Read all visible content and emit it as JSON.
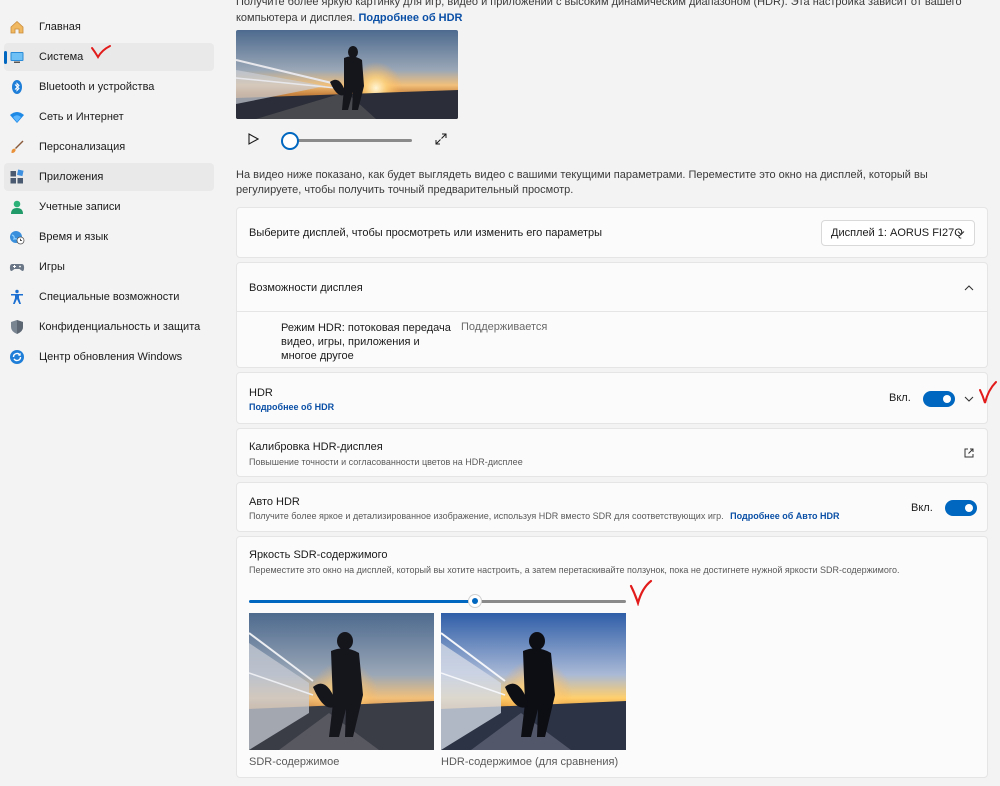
{
  "sidebar": {
    "items": [
      {
        "label": "Главная",
        "icon": "home-icon"
      },
      {
        "label": "Система",
        "icon": "system-display-icon"
      },
      {
        "label": "Bluetooth и устройства",
        "icon": "bluetooth-icon"
      },
      {
        "label": "Сеть и Интернет",
        "icon": "wifi-icon"
      },
      {
        "label": "Персонализация",
        "icon": "paint-brush-icon"
      },
      {
        "label": "Приложения",
        "icon": "apps-icon"
      },
      {
        "label": "Учетные записи",
        "icon": "account-icon"
      },
      {
        "label": "Время и язык",
        "icon": "globe-clock-icon"
      },
      {
        "label": "Игры",
        "icon": "gamepad-icon"
      },
      {
        "label": "Специальные возможности",
        "icon": "accessibility-icon"
      },
      {
        "label": "Конфиденциальность и защита",
        "icon": "shield-icon"
      },
      {
        "label": "Центр обновления Windows",
        "icon": "update-icon"
      }
    ]
  },
  "intro": {
    "text": "Получите более яркую картинку для игр, видео и приложений с высоким динамическим диапазоном (HDR). Эта настройка зависит от вашего компьютера и дисплея.",
    "link": "Подробнее об HDR"
  },
  "player": {
    "progress": 0
  },
  "description": "На видео ниже показано, как будет выглядеть видео с вашими текущими параметрами. Переместите это окно на дисплей, который вы регулируете, чтобы получить точный предварительный просмотр.",
  "display_select": {
    "title": "Выберите дисплей, чтобы просмотреть или изменить его параметры",
    "value": "Дисплей 1: AORUS FI27Q"
  },
  "capabilities": {
    "title": "Возможности дисплея",
    "feature_label": "Режим HDR: потоковая передача видео, игры, приложения и многое другое",
    "feature_value": "Поддерживается"
  },
  "hdr": {
    "title": "HDR",
    "link": "Подробнее об HDR",
    "state_label": "Вкл.",
    "enabled": true
  },
  "calibration": {
    "title": "Калибровка HDR-дисплея",
    "subtitle": "Повышение точности и согласованности цветов на HDR-дисплее"
  },
  "auto_hdr": {
    "title": "Авто HDR",
    "subtitle": "Получите более яркое и детализированное изображение, используя HDR вместо SDR для соответствующих игр.",
    "link": "Подробнее об Авто HDR",
    "state_label": "Вкл.",
    "enabled": true
  },
  "sdr_brightness": {
    "title": "Яркость SDR-содержимого",
    "subtitle": "Переместите это окно на дисплей, который вы хотите настроить, а затем перетаскивайте ползунок, пока не достигнете нужной яркости SDR-содержимого.",
    "slider_fraction": 0.6,
    "sdr_caption": "SDR-содержимое",
    "hdr_caption": "HDR-содержимое (для сравнения)"
  },
  "colors": {
    "accent": "#0067c0",
    "link": "#0a4fa6",
    "annotation": "#e21b1b"
  }
}
